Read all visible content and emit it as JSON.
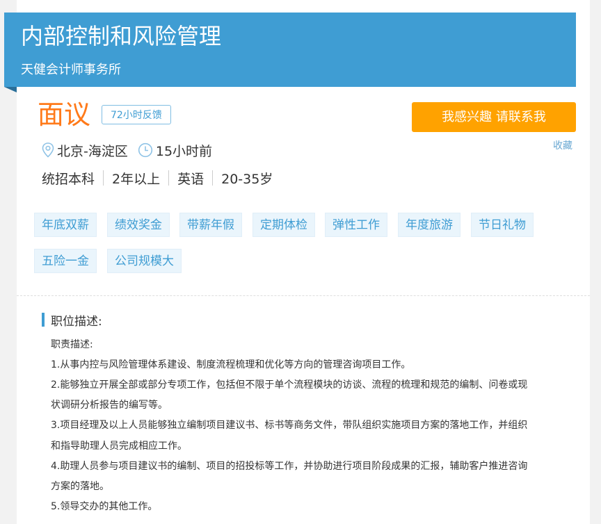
{
  "header": {
    "job_title": "内部控制和风险管理",
    "company": "天健会计师事务所"
  },
  "salary": "面议",
  "feedback_badge": "72小时反馈",
  "interest_button": "我感兴趣 请联系我",
  "favorite": "收藏",
  "location": "北京-海淀区",
  "posted_time": "15小时前",
  "requirements": [
    "统招本科",
    "2年以上",
    "英语",
    "20-35岁"
  ],
  "benefits": [
    "年底双薪",
    "绩效奖金",
    "带薪年假",
    "定期体检",
    "弹性工作",
    "年度旅游",
    "节日礼物",
    "五险一金",
    "公司规模大"
  ],
  "description": {
    "section_title": "职位描述:",
    "lines": [
      "职责描述:",
      "1.从事内控与风险管理体系建设、制度流程梳理和优化等方向的管理咨询项目工作。",
      "2.能够独立开展全部或部分专项工作，包括但不限于单个流程模块的访谈、流程的梳理和规范的编制、问卷或现",
      "状调研分析报告的编写等。",
      "3.项目经理及以上人员能够独立编制项目建议书、标书等商务文件，带队组织实施项目方案的落地工作，并组织",
      "和指导助理人员完成相应工作。",
      "4.助理人员参与项目建议书的编制、项目的招投标等工作，并协助进行项目阶段成果的汇报，辅助客户推进咨询",
      "方案的落地。",
      "5.领导交办的其他工作。"
    ]
  },
  "colors": {
    "banner": "#3f9dd3",
    "salary": "#ff7a1a",
    "interest_button": "#ffa200",
    "tag_bg": "#eaf5fc",
    "tag_text": "#3f9dd3"
  }
}
